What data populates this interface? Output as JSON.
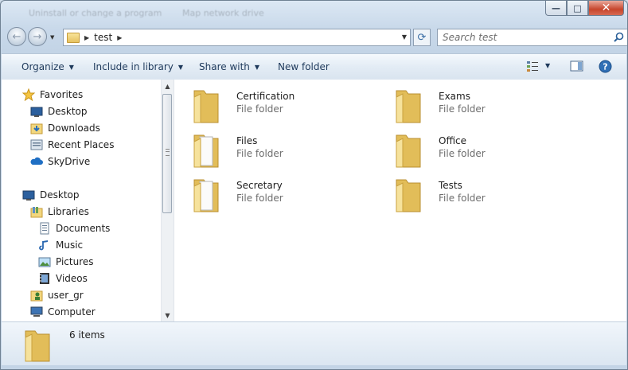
{
  "window": {
    "ghost_text_1": "Uninstall or change a program",
    "ghost_text_2": "Map network drive",
    "min_glyph": "—",
    "max_glyph": "□",
    "close_glyph": "✕"
  },
  "nav": {
    "back_glyph": "←",
    "forward_glyph": "→",
    "breadcrumb": [
      "test"
    ],
    "refresh_glyph": "⟳",
    "search_placeholder": "Search test",
    "search_icon": "magnifier-icon"
  },
  "toolbar": {
    "organize": "Organize",
    "include_library": "Include in library",
    "share_with": "Share with",
    "new_folder": "New folder",
    "help_glyph": "?"
  },
  "sidebar": {
    "favorites_label": "Favorites",
    "favorites": [
      "Desktop",
      "Downloads",
      "Recent Places",
      "SkyDrive"
    ],
    "desktop_label": "Desktop",
    "libraries_label": "Libraries",
    "libraries": [
      "Documents",
      "Music",
      "Pictures",
      "Videos"
    ],
    "user_label": "user_gr",
    "computer_label": "Computer"
  },
  "folders": [
    {
      "name": "Certification",
      "type": "File folder"
    },
    {
      "name": "Exams",
      "type": "File folder"
    },
    {
      "name": "Files",
      "type": "File folder"
    },
    {
      "name": "Office",
      "type": "File folder"
    },
    {
      "name": "Secretary",
      "type": "File folder"
    },
    {
      "name": "Tests",
      "type": "File folder"
    }
  ],
  "status": {
    "item_count": "6 items"
  },
  "colors": {
    "accent": "#1e395b",
    "folder": "#f2d77e",
    "status_bg": "#dbe6f1"
  }
}
